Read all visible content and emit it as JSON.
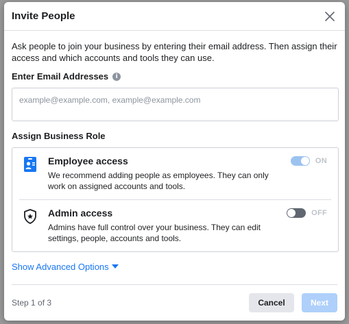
{
  "dialog": {
    "title": "Invite People",
    "close_icon": "close-icon"
  },
  "intro": "Ask people to join your business by entering their email address. Then assign their access and which accounts and tools they can use.",
  "email": {
    "label": "Enter Email Addresses",
    "info_icon": "info-icon",
    "value": "",
    "placeholder": "example@example.com, example@example.com"
  },
  "roles": {
    "label": "Assign Business Role",
    "items": [
      {
        "icon": "employee-badge-icon",
        "name": "Employee access",
        "description": "We recommend adding people as employees. They can only work on assigned accounts and tools.",
        "toggle_on": true,
        "toggle_label": "ON"
      },
      {
        "icon": "admin-shield-icon",
        "name": "Admin access",
        "description": "Admins have full control over your business. They can edit settings, people, accounts and tools.",
        "toggle_on": false,
        "toggle_label": "OFF"
      }
    ]
  },
  "advanced": {
    "label": "Show Advanced Options",
    "icon": "caret-down-icon"
  },
  "footer": {
    "step": "Step 1 of 3",
    "cancel_label": "Cancel",
    "next_label": "Next"
  },
  "colors": {
    "accent": "#1877f2",
    "next_disabled": "#aed0fa",
    "toggle_on": "#9cc3f0",
    "toggle_off": "#606770"
  }
}
